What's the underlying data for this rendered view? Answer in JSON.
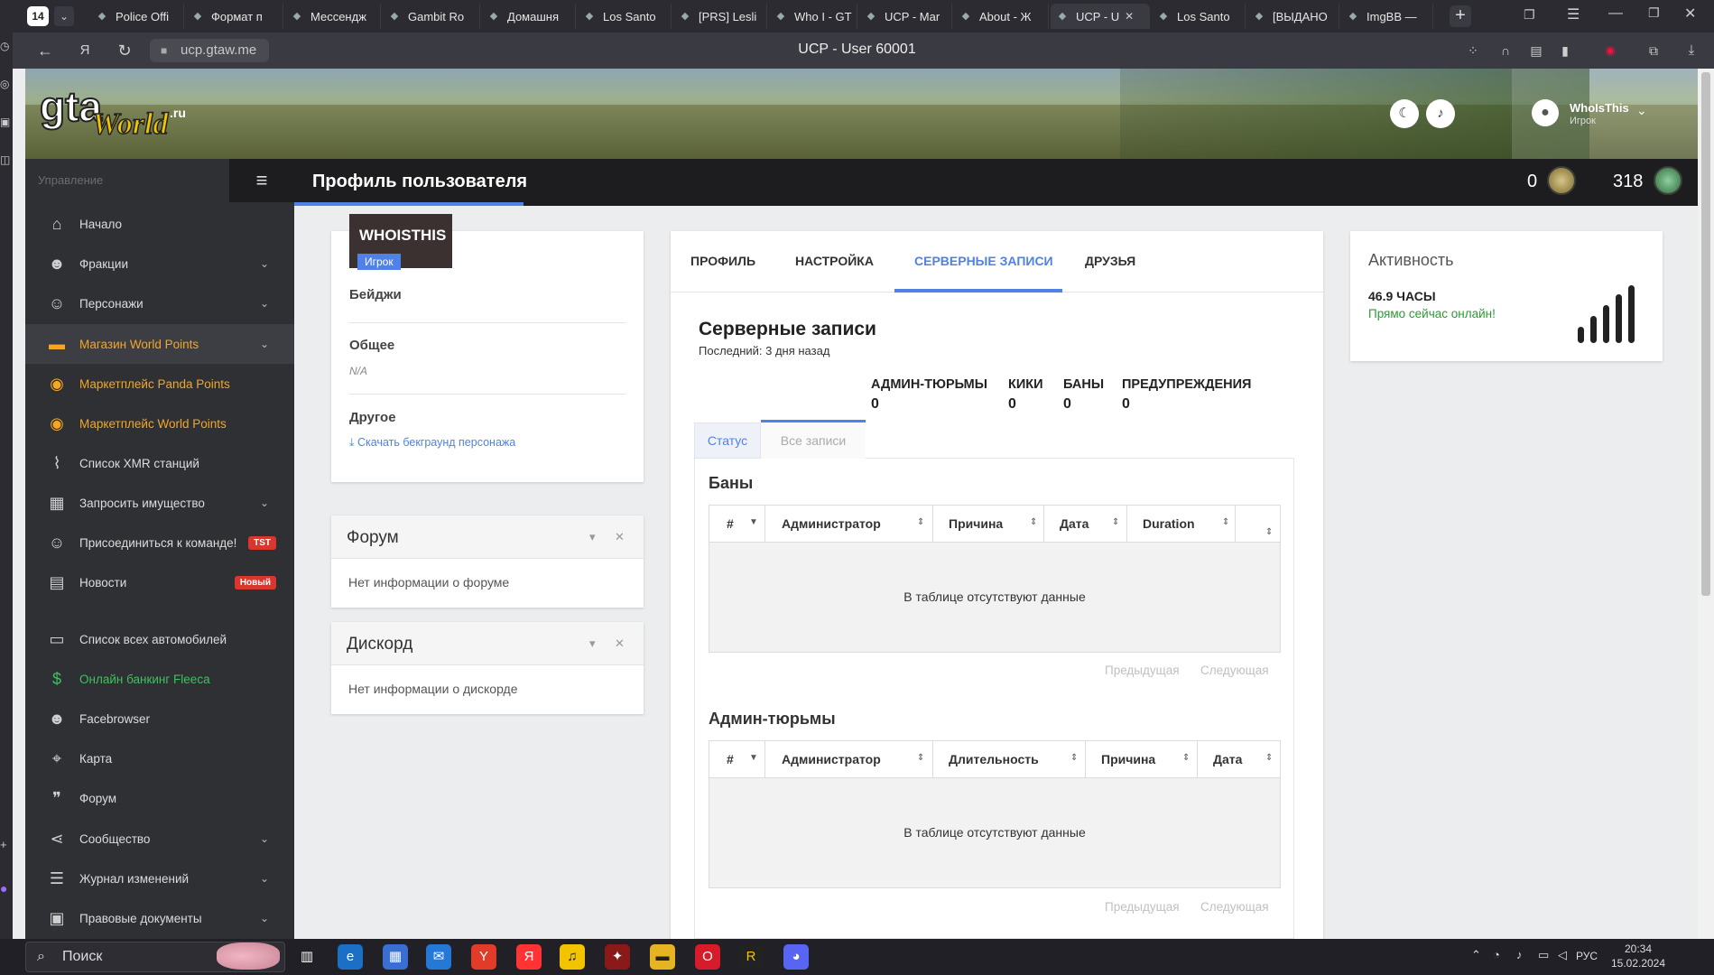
{
  "browser": {
    "tab_count": "14",
    "tabs": [
      {
        "label": "Police Offi",
        "icon": "shield-icon"
      },
      {
        "label": "Формат п",
        "icon": "doc-icon"
      },
      {
        "label": "Мессендж",
        "icon": "chat-icon"
      },
      {
        "label": "Gambit Ro",
        "icon": "g-icon"
      },
      {
        "label": "Домашня",
        "icon": "vk-icon"
      },
      {
        "label": "Los Santo",
        "icon": "page-icon"
      },
      {
        "label": "[PRS] Lesli",
        "icon": "page-icon"
      },
      {
        "label": "Who I - GT",
        "icon": "gta-icon"
      },
      {
        "label": "UCP - Mar",
        "icon": "gta-icon"
      },
      {
        "label": "About - Ж",
        "icon": "gta-icon"
      },
      {
        "label": "UCP - U",
        "icon": "gta-icon"
      },
      {
        "label": "Los Santo",
        "icon": "page-icon"
      },
      {
        "label": "[ВЫДАНО",
        "icon": "page-icon"
      },
      {
        "label": "ImgBB — ",
        "icon": "ibb-icon"
      }
    ],
    "url": "ucp.gtaw.me",
    "page_title": "UCP - User 60001"
  },
  "header": {
    "logo_text": "gta World .ru",
    "username": "WhoIsThis",
    "userrole": "Игрок",
    "points_panda": "0",
    "points_world": "318"
  },
  "sidebar": {
    "section": "Управление",
    "items": [
      {
        "label": "Начало",
        "icon": "home-icon"
      },
      {
        "label": "Фракции",
        "icon": "users-icon"
      },
      {
        "label": "Персонажи",
        "icon": "user-icon"
      },
      {
        "label": "Магазин World Points",
        "icon": "cart-icon"
      },
      {
        "label": "Маркетплейс Panda Points",
        "icon": "coins-icon"
      },
      {
        "label": "Маркетплейс World Points",
        "icon": "coins-icon"
      },
      {
        "label": "Список XMR станций",
        "icon": "antenna-icon"
      },
      {
        "label": "Запросить имущество",
        "icon": "building-icon"
      },
      {
        "label": "Присоединиться к команде!",
        "icon": "user-plus-icon",
        "badge": "TST"
      },
      {
        "label": "Новости",
        "icon": "news-icon",
        "badge": "Новый"
      },
      {
        "label": "Список всех автомобилей",
        "icon": "car-icon"
      },
      {
        "label": "Онлайн банкинг Fleeca",
        "icon": "money-icon"
      },
      {
        "label": "Facebrowser",
        "icon": "users-icon"
      },
      {
        "label": "Карта",
        "icon": "map-icon"
      },
      {
        "label": "Форум",
        "icon": "comments-icon"
      },
      {
        "label": "Сообщество",
        "icon": "share-icon"
      },
      {
        "label": "Журнал изменений",
        "icon": "list-icon"
      },
      {
        "label": "Правовые документы",
        "icon": "doc-icon"
      }
    ]
  },
  "page": {
    "title": "Профиль пользователя"
  },
  "profile": {
    "name": "WHOISTHIS",
    "role": "Игрок",
    "badges_label": "Бейджи",
    "general_label": "Общее",
    "general_value": "N/A",
    "other_label": "Другое",
    "download_link": "Скачать бекграунд персонажа"
  },
  "forum_box": {
    "title": "Форум",
    "body": "Нет информации о форуме"
  },
  "discord_box": {
    "title": "Дискорд",
    "body": "Нет информации о дискорде"
  },
  "tabs": [
    "ПРОФИЛЬ",
    "НАСТРОЙКА",
    "СЕРВЕРНЫЕ ЗАПИСИ",
    "ДРУЗЬЯ"
  ],
  "records": {
    "title": "Серверные записи",
    "last": "Последний: 3 дня назад",
    "stats": [
      {
        "label": "АДМИН-ТЮРЬМЫ",
        "value": "0"
      },
      {
        "label": "КИКИ",
        "value": "0"
      },
      {
        "label": "БАНЫ",
        "value": "0"
      },
      {
        "label": "ПРЕДУПРЕЖДЕНИЯ",
        "value": "0"
      }
    ],
    "subtabs": [
      "Статус",
      "Все записи"
    ],
    "bans": {
      "title": "Баны",
      "cols": [
        "#",
        "Администратор",
        "Причина",
        "Дата",
        "Duration"
      ],
      "empty": "В таблице отсутствуют данные"
    },
    "jails": {
      "title": "Админ-тюрьмы",
      "cols": [
        "#",
        "Администратор",
        "Длительность",
        "Причина",
        "Дата"
      ],
      "empty": "В таблице отсутствуют данные"
    },
    "prev": "Предыдущая",
    "next": "Следующая"
  },
  "activity": {
    "title": "Активность",
    "hours": "46.9 ЧАСЫ",
    "status": "Прямо сейчас онлайн!"
  },
  "taskbar": {
    "search": "Поиск",
    "lang": "РУС",
    "time": "20:34",
    "date": "15.02.2024"
  }
}
